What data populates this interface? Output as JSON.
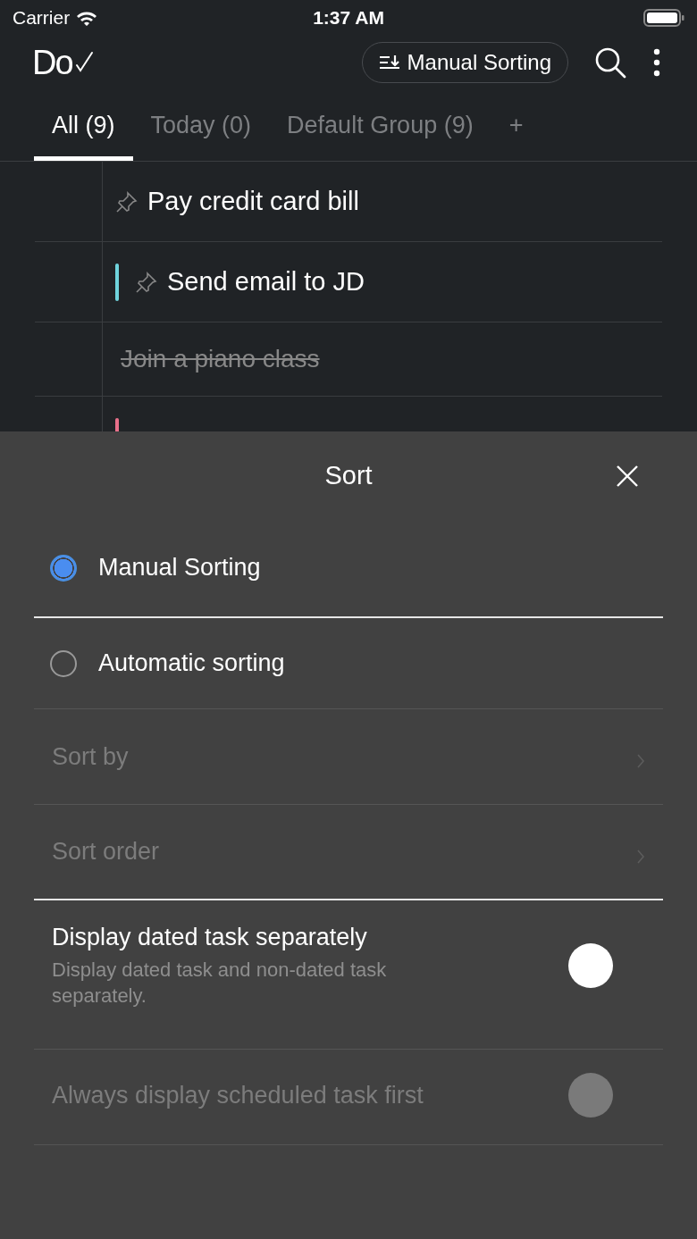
{
  "status_bar": {
    "carrier": "Carrier",
    "time": "1:37 AM"
  },
  "header": {
    "logo": "Do",
    "sort_button": "Manual Sorting"
  },
  "tabs": [
    {
      "label": "All (9)",
      "selected": true
    },
    {
      "label": "Today (0)",
      "selected": false
    },
    {
      "label": "Default Group (9)",
      "selected": false
    },
    {
      "label": "+",
      "selected": false
    }
  ],
  "tasks": [
    {
      "title": "Pay credit card bill",
      "pinned": true,
      "done": false
    },
    {
      "title": "Send email to JD",
      "pinned": true,
      "done": false,
      "color": "#6fd3dc"
    },
    {
      "title": "Join a piano class",
      "pinned": false,
      "done": true
    },
    {
      "pinned": false,
      "done": false,
      "color": "#e8708a"
    }
  ],
  "sheet": {
    "title": "Sort",
    "options": [
      {
        "label": "Manual Sorting",
        "selected": true
      },
      {
        "label": "Automatic sorting",
        "selected": false
      }
    ],
    "links": [
      {
        "label": "Sort by",
        "disabled": true
      },
      {
        "label": "Sort order",
        "disabled": true
      }
    ],
    "toggles": [
      {
        "label": "Display dated task separately",
        "description": "Display dated task and non-dated task separately.",
        "on": false,
        "disabled": false
      },
      {
        "label": "Always display scheduled task first",
        "on": false,
        "disabled": true
      }
    ]
  }
}
